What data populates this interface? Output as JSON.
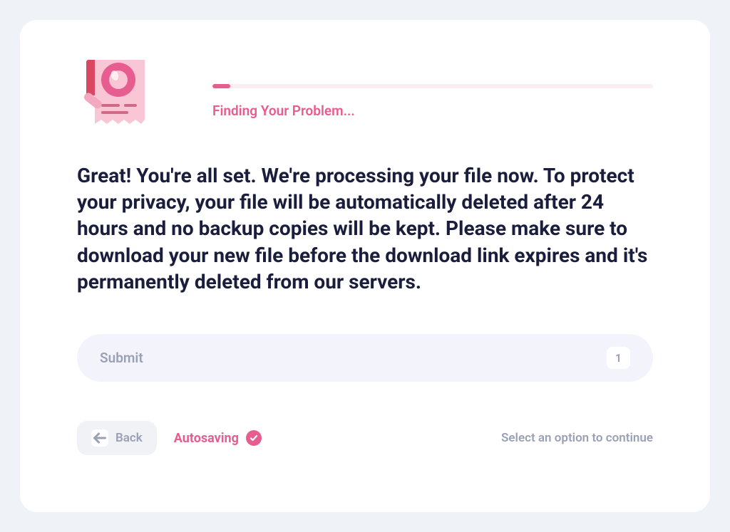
{
  "progress": {
    "label": "Finding Your Problem...",
    "percent": 4
  },
  "main_text": "Great! You're all set. We're processing your file now. To protect your privacy, your file will be automatically deleted after 24 hours and no backup copies will be kept. Please make sure to download your new file before the download link expires and it's permanently deleted from our servers.",
  "submit": {
    "label": "Submit",
    "badge": "1"
  },
  "footer": {
    "back_label": "Back",
    "autosave_label": "Autosaving",
    "continue_hint": "Select an option to continue"
  }
}
